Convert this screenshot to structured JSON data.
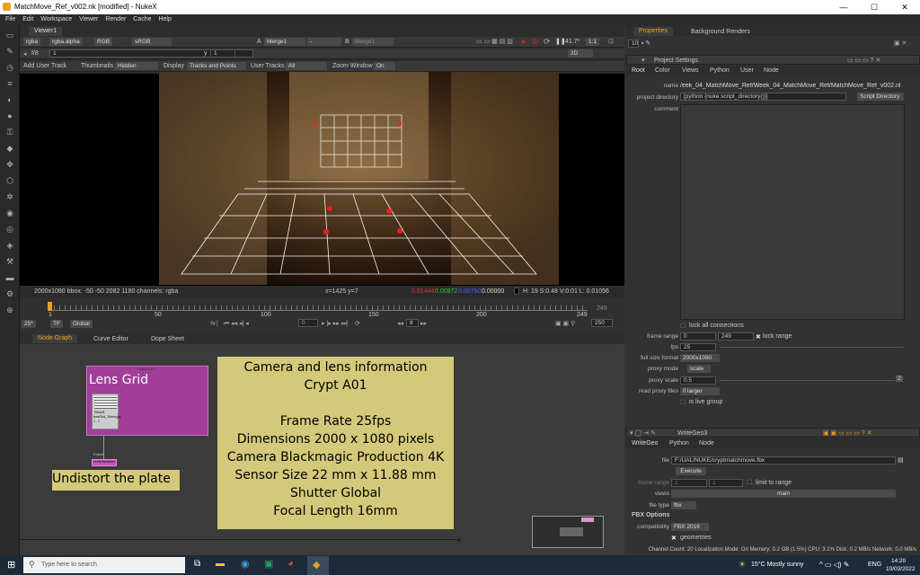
{
  "window": {
    "title": "MatchMove_Ref_v002.nk [modified] - NukeX",
    "min": "—",
    "max": "☐",
    "close": "✕"
  },
  "menu": [
    "File",
    "Edit",
    "Workspace",
    "Viewer",
    "Render",
    "Cache",
    "Help"
  ],
  "viewer": {
    "tab": "Viewer1",
    "channels": "rgba",
    "alpha": "rgba.alpha",
    "rgb": "RGB",
    "colorspace": "sRGB",
    "input_a_label": "A",
    "input_a": "Merge1",
    "input_a_op": "-",
    "input_b_label": "B",
    "input_b": "Merge1",
    "zoom": "41.7*",
    "ratio": "1:1",
    "fstop": "f/8",
    "frame_one": "1",
    "y_label": "y",
    "y_val": "1",
    "mode2d": "2D",
    "add_user_track": "Add User Track",
    "thumbnails_label": "Thumbnails",
    "thumbnails_val": "Hidden",
    "display_label": "Display",
    "display_val": "Tracks and Points",
    "user_tracks_label": "User Tracks",
    "user_tracks_val": "All",
    "zoom_window_label": "Zoom Window",
    "zoom_window_val": "On",
    "info_left": "2000x1080  bbox: -50 -50 2082 1180 channels: rgba",
    "info_xy": "x=1425 y=7",
    "info_r": "0.01444",
    "info_g": "0.00972",
    "info_b": "0.00750",
    "info_a": "0.00000",
    "info_hsv": "H: 19 S:0.48 V:0.01  L: 0.01056"
  },
  "timeline": {
    "ticks": [
      "1",
      "50",
      "100",
      "150",
      "200",
      "249"
    ],
    "end_frame": "249",
    "fps": "25*",
    "tf": "TF",
    "global": "Global",
    "current_frame": "0",
    "step": "8",
    "out_frame": "250"
  },
  "nodegraph": {
    "tabs": [
      "Node Graph",
      "Curve Editor",
      "Dope Sheet"
    ],
    "backdrop_small": "Backdrop1",
    "backdrop_title": "Lens Grid",
    "read_label": "Read1",
    "read_file": "lensGrid_16mm.jpg",
    "read_range": "1 - 1",
    "frame_label": "Frame",
    "undistort_node": "LensDistortion1",
    "undistort_title": "Undistort the plate",
    "info_lines": [
      "Camera and lens information",
      "Crypt A01",
      "",
      "Frame Rate 25fps",
      "Dimensions 2000 x 1080 pixels",
      "Camera Blackmagic Production 4K",
      "Sensor Size 22 mm x 11.88 mm",
      "Shutter Global",
      "Focal Length 16mm"
    ]
  },
  "props": {
    "tabs": [
      "Properties",
      "Background Renders"
    ],
    "count": "10",
    "panel_title": "Project Settings",
    "subtabs": [
      "Root",
      "Color",
      "Views",
      "Python",
      "User",
      "Node"
    ],
    "name_label": "name",
    "name_val": "/eek_04_MatchMove_Ref/Week_04_MatchMove_Ref/MatchMove_Ref_v002.nk",
    "projdir_label": "project directory",
    "projdir_val": "[python {nuke.script_directory()}]",
    "script_dir_btn": "Script Directory",
    "comment_label": "comment",
    "lock_all": "lock all connections",
    "frame_range_label": "frame range",
    "fr_start": "0",
    "fr_end": "249",
    "lock_range": "lock range",
    "fps_label": "fps",
    "fps_val": "25",
    "fullsize_label": "full size format",
    "fullsize_val": "2000x1080",
    "proxy_mode_label": "proxy mode",
    "proxy_mode_val": "scale",
    "proxy_scale_label": "proxy scale",
    "proxy_scale_val": "0.5",
    "read_proxy_label": "read proxy files",
    "read_proxy_val": "if larger",
    "is_live": "is live group",
    "write_title": "WriteGeo3",
    "write_tabs": [
      "WriteGeo",
      "Python",
      "Node"
    ],
    "file_label": "file",
    "file_val": "F:/UAL/NUKE/cryptmatchmove.fbx",
    "execute_btn": "Execute",
    "w_frame_range_label": "frame range",
    "w_fr_start": "1",
    "w_fr_end": "1",
    "limit_range": "limit to range",
    "views_label": "views",
    "views_val": "main",
    "file_type_label": "file type",
    "file_type_val": "fbx",
    "fbx_options": "FBX Options",
    "compat_label": "compatibility",
    "compat_val": "FBX 2016",
    "geometries": "geometries"
  },
  "status": "Channel Count: 20  Localization Mode: On  Memory: 0.2 GB (1.5%)  CPU: 3.1%  Disk: 0.2 MB/s  Network: 0.0 MB/s",
  "taskbar": {
    "search": "Type here to search",
    "weather": "15°C  Mostly sunny",
    "lang": "ENG",
    "time": "14:20",
    "date": "10/03/2022"
  }
}
